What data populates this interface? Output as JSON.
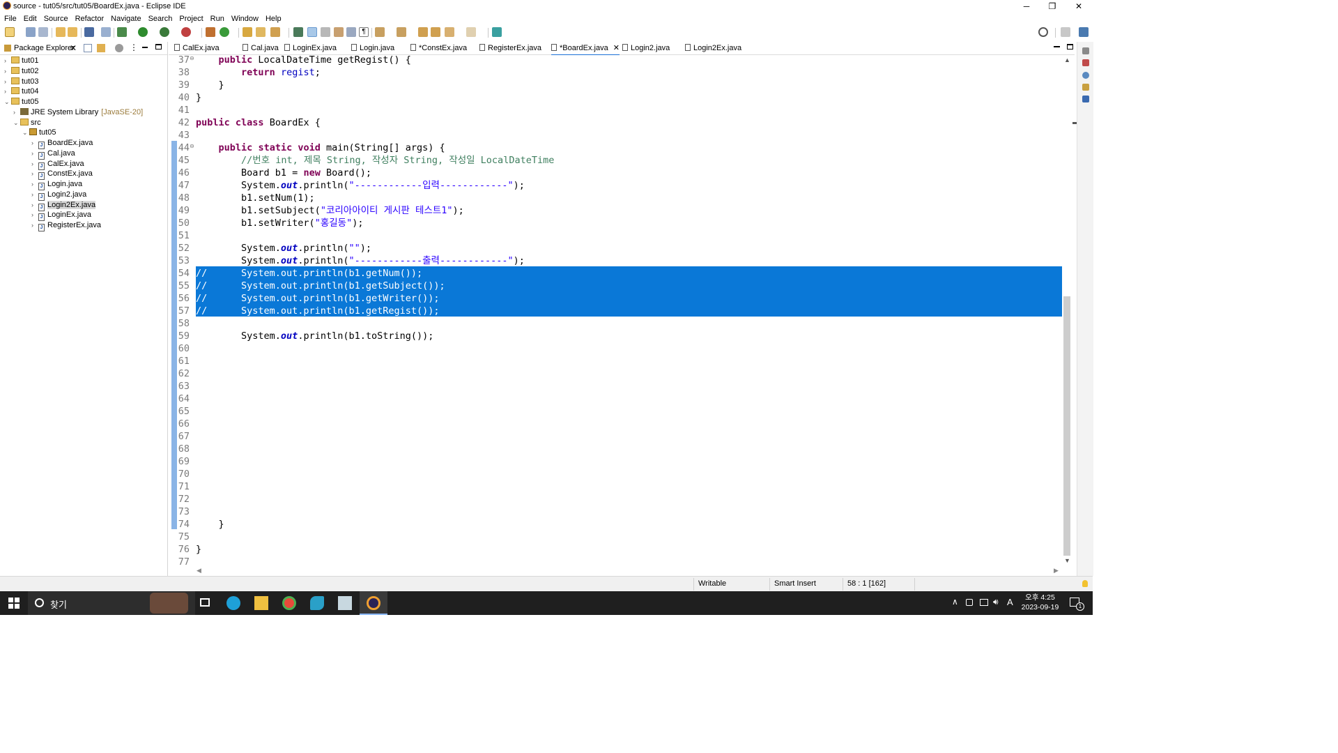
{
  "window": {
    "title": "source - tut05/src/tut05/BoardEx.java - Eclipse IDE",
    "controls": [
      "─",
      "❐",
      "✕"
    ]
  },
  "menu": [
    "File",
    "Edit",
    "Source",
    "Refactor",
    "Navigate",
    "Search",
    "Project",
    "Run",
    "Window",
    "Help"
  ],
  "package_explorer": {
    "title": "Package Explorer",
    "tree": [
      {
        "label": "tut01",
        "indent": 0,
        "chev": "›",
        "icon": "project"
      },
      {
        "label": "tut02",
        "indent": 0,
        "chev": "›",
        "icon": "project"
      },
      {
        "label": "tut03",
        "indent": 0,
        "chev": "›",
        "icon": "project"
      },
      {
        "label": "tut04",
        "indent": 0,
        "chev": "›",
        "icon": "project"
      },
      {
        "label": "tut05",
        "indent": 0,
        "chev": "⌄",
        "icon": "project"
      },
      {
        "label": "JRE System Library",
        "decor": "[JavaSE-20]",
        "indent": 1,
        "chev": "›",
        "icon": "library"
      },
      {
        "label": "src",
        "indent": 1,
        "chev": "⌄",
        "icon": "folder"
      },
      {
        "label": "tut05",
        "indent": 2,
        "chev": "⌄",
        "icon": "package"
      },
      {
        "label": "BoardEx.java",
        "indent": 3,
        "chev": "›",
        "icon": "java"
      },
      {
        "label": "Cal.java",
        "indent": 3,
        "chev": "›",
        "icon": "java"
      },
      {
        "label": "CalEx.java",
        "indent": 3,
        "chev": "›",
        "icon": "java"
      },
      {
        "label": "ConstEx.java",
        "indent": 3,
        "chev": "›",
        "icon": "java"
      },
      {
        "label": "Login.java",
        "indent": 3,
        "chev": "›",
        "icon": "java"
      },
      {
        "label": "Login2.java",
        "indent": 3,
        "chev": "›",
        "icon": "java"
      },
      {
        "label": "Login2Ex.java",
        "indent": 3,
        "chev": "›",
        "icon": "java",
        "selected": true
      },
      {
        "label": "LoginEx.java",
        "indent": 3,
        "chev": "›",
        "icon": "java"
      },
      {
        "label": "RegisterEx.java",
        "indent": 3,
        "chev": "›",
        "icon": "java"
      }
    ]
  },
  "editor_tabs": [
    {
      "label": "CalEx.java"
    },
    {
      "label": "Cal.java"
    },
    {
      "label": "LoginEx.java"
    },
    {
      "label": "Login.java"
    },
    {
      "label": "*ConstEx.java"
    },
    {
      "label": "RegisterEx.java"
    },
    {
      "label": "*BoardEx.java",
      "active": true
    },
    {
      "label": "Login2.java"
    },
    {
      "label": "Login2Ex.java"
    }
  ],
  "code_lines": [
    {
      "n": "37",
      "fold": true,
      "html": "    <span class='kw'>public</span> LocalDateTime getRegist() {"
    },
    {
      "n": "38",
      "html": "        <span class='kw'>return</span> <span class='fld'>regist</span>;"
    },
    {
      "n": "39",
      "html": "    }"
    },
    {
      "n": "40",
      "html": "}"
    },
    {
      "n": "41",
      "html": ""
    },
    {
      "n": "42",
      "html": "<span class='kw'>public</span> <span class='kw'>class</span> BoardEx {"
    },
    {
      "n": "43",
      "html": ""
    },
    {
      "n": "44",
      "fold": true,
      "html": "    <span class='kw'>public</span> <span class='kw'>static</span> <span class='kw'>void</span> main(String[] args) {"
    },
    {
      "n": "45",
      "html": "        <span class='cm'>//번호 int, 제목 String, 작성자 String, 작성일 LocalDateTime</span>"
    },
    {
      "n": "46",
      "html": "        Board b1 = <span class='kw'>new</span> Board();"
    },
    {
      "n": "47",
      "html": "        System.<span class='sfld'>out</span>.println(<span class='str'>\"------------입력------------\"</span>);"
    },
    {
      "n": "48",
      "html": "        b1.setNum(1);"
    },
    {
      "n": "49",
      "html": "        b1.setSubject(<span class='str'>\"코리아아이티 게시판 테스트1\"</span>);"
    },
    {
      "n": "50",
      "html": "        b1.setWriter(<span class='str'>\"홍길동\"</span>);"
    },
    {
      "n": "51",
      "html": ""
    },
    {
      "n": "52",
      "html": "        System.<span class='sfld'>out</span>.println(<span class='str'>\"\"</span>);"
    },
    {
      "n": "53",
      "html": "        System.<span class='sfld'>out</span>.println(<span class='str'>\"------------출력------------\"</span>);"
    },
    {
      "n": "54",
      "sel": true,
      "html": "//      System.out.println(b1.getNum());"
    },
    {
      "n": "55",
      "sel": true,
      "html": "//      System.out.println(b1.getSubject());"
    },
    {
      "n": "56",
      "sel": true,
      "html": "//      System.out.println(b1.getWriter());"
    },
    {
      "n": "57",
      "sel": true,
      "html": "//      System.out.println(b1.getRegist());"
    },
    {
      "n": "58",
      "html": ""
    },
    {
      "n": "59",
      "html": "        System.<span class='sfld'>out</span>.println(b1.toString());"
    },
    {
      "n": "60",
      "html": ""
    },
    {
      "n": "61",
      "html": ""
    },
    {
      "n": "62",
      "html": ""
    },
    {
      "n": "63",
      "html": ""
    },
    {
      "n": "64",
      "html": ""
    },
    {
      "n": "65",
      "html": ""
    },
    {
      "n": "66",
      "html": ""
    },
    {
      "n": "67",
      "html": ""
    },
    {
      "n": "68",
      "html": ""
    },
    {
      "n": "69",
      "html": ""
    },
    {
      "n": "70",
      "html": ""
    },
    {
      "n": "71",
      "html": ""
    },
    {
      "n": "72",
      "html": ""
    },
    {
      "n": "73",
      "html": ""
    },
    {
      "n": "74",
      "html": "    }"
    },
    {
      "n": "75",
      "html": ""
    },
    {
      "n": "76",
      "html": "}"
    },
    {
      "n": "77",
      "html": ""
    }
  ],
  "status": {
    "mode": "Writable",
    "insert": "Smart Insert",
    "position": "58 : 1 [162]"
  },
  "taskbar": {
    "search_label": "찾기",
    "time": "오후 4:25",
    "date": "2023-09-19",
    "ime": "A",
    "notification_count": "1"
  },
  "colors": {
    "selection": "#0a78d7",
    "keyword": "#7f0055",
    "comment": "#3f7f5f",
    "string": "#2a00ff",
    "field": "#0000c0"
  }
}
